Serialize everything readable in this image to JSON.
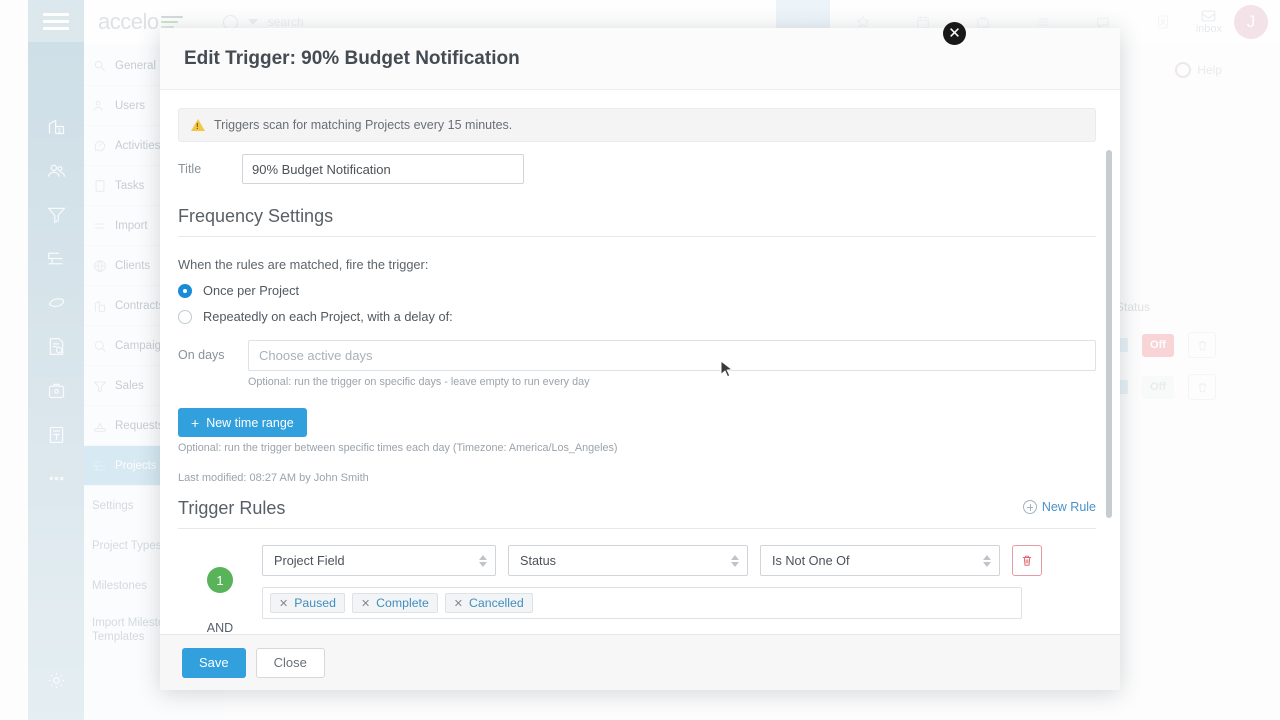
{
  "background": {
    "logo": "accelo",
    "search_placeholder": "search",
    "inbox_label": "inbox",
    "avatar_initial": "J",
    "help_label": "Help",
    "rail_icons": [
      "menu-icon",
      "company-icon",
      "people-icon",
      "funnel-icon",
      "project-icon",
      "tag-icon",
      "report-icon",
      "briefcase-icon",
      "invoice-icon",
      "more-icon",
      "gear-icon"
    ],
    "topright_icons": [
      "plus-icon",
      "star-icon",
      "calendar-icon",
      "briefcase-icon",
      "list-icon",
      "chat-icon",
      "contact-icon"
    ],
    "sidebar_items": [
      {
        "label": "General",
        "icon": "search-user-icon"
      },
      {
        "label": "Users",
        "icon": "users-icon"
      },
      {
        "label": "Activities",
        "icon": "activity-icon"
      },
      {
        "label": "Tasks",
        "icon": "task-icon"
      },
      {
        "label": "Import",
        "icon": "import-icon"
      },
      {
        "label": "Clients",
        "icon": "globe-icon"
      },
      {
        "label": "Contracts",
        "icon": "contract-icon"
      },
      {
        "label": "Campaigns",
        "icon": "campaign-icon"
      },
      {
        "label": "Sales",
        "icon": "sales-icon"
      },
      {
        "label": "Requests",
        "icon": "request-icon"
      },
      {
        "label": "Projects",
        "icon": "projects-icon"
      }
    ],
    "sidebar_active": "Projects",
    "sidebar_subitems": [
      "Settings",
      "Project Types",
      "Milestones",
      "Import Milestone Templates"
    ],
    "right_panel": {
      "header": "Status",
      "rows": [
        {
          "toggle": "Off",
          "toggle_state": "on",
          "delete_icon": "trash-icon"
        },
        {
          "toggle": "Off",
          "toggle_state": "off",
          "delete_icon": "trash-icon"
        }
      ]
    }
  },
  "modal": {
    "title": "Edit Trigger: 90% Budget Notification",
    "close_icon": "close-icon",
    "notice": {
      "icon": "warning-icon",
      "text": "Triggers scan for matching Projects every 15 minutes."
    },
    "title_field": {
      "label": "Title",
      "value": "90% Budget Notification"
    },
    "frequency": {
      "heading": "Frequency Settings",
      "question": "When the rules are matched, fire the trigger:",
      "options": [
        {
          "label": "Once per Project",
          "selected": true
        },
        {
          "label": "Repeatedly on each Project, with a delay of:",
          "selected": false
        }
      ],
      "days": {
        "label": "On days",
        "value": "",
        "placeholder": "Choose active days",
        "hint": "Optional: run the trigger on specific days - leave empty to run every day"
      },
      "new_time_range_label": "New time range",
      "new_time_range_icon": "plus-icon",
      "time_hint": "Optional: run the trigger between specific times each day (Timezone: America/Los_Angeles)",
      "last_modified": "Last modified: 08:27 AM by John Smith"
    },
    "rules": {
      "heading": "Trigger Rules",
      "new_rule_label": "New Rule",
      "new_rule_icon": "plus-circle-icon",
      "items": [
        {
          "number": "1",
          "field_type": "Project Field",
          "field": "Status",
          "operator": "Is Not One Of",
          "values": [
            "Paused",
            "Complete",
            "Cancelled"
          ],
          "delete_icon": "trash-icon",
          "conjunction": "AND"
        }
      ]
    },
    "footer": {
      "save_label": "Save",
      "close_label": "Close"
    }
  },
  "colors": {
    "accent": "#31a0dc",
    "radio_on": "#1a8bd8",
    "badge_green": "#58b359",
    "delete_red": "#d9555f",
    "warning_yellow": "#f2c744"
  }
}
